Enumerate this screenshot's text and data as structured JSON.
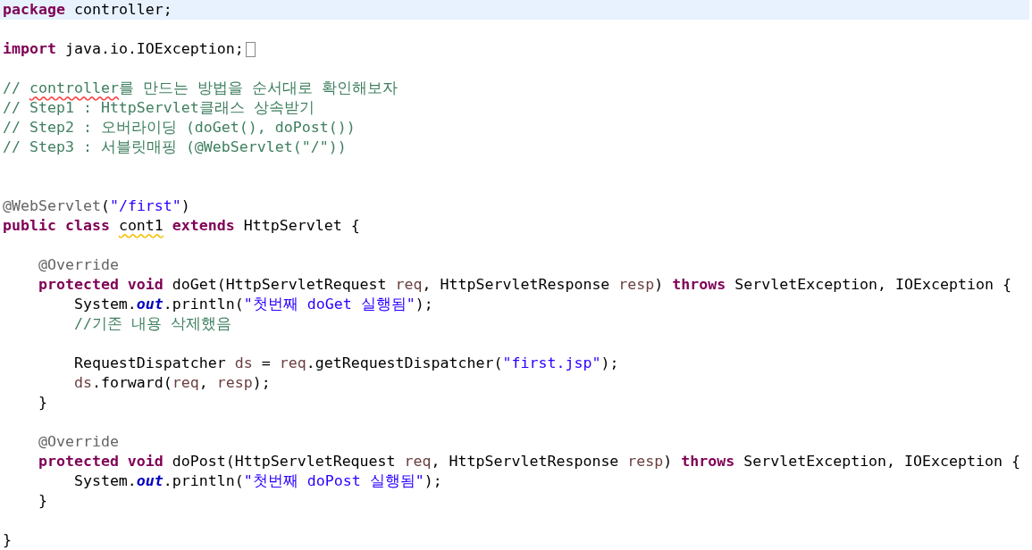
{
  "editor": {
    "lines": [
      {
        "current": true,
        "folded": false,
        "tokens": [
          {
            "kind": "keyword",
            "text": "package"
          },
          {
            "kind": "plain",
            "text": " controller;"
          }
        ]
      },
      {
        "current": false,
        "folded": false
      },
      {
        "current": false,
        "folded": true,
        "tokens": [
          {
            "kind": "keyword",
            "text": "import"
          },
          {
            "kind": "plain",
            "text": " java.io.IOException;"
          }
        ]
      },
      {
        "current": false,
        "folded": false
      },
      {
        "current": false,
        "folded": false,
        "tokens": [
          {
            "kind": "comment",
            "text": "// "
          },
          {
            "kind": "comment",
            "text": "controller",
            "misspelled": true
          },
          {
            "kind": "comment",
            "text": "를 만드는 방법을 순서대로 확인해보자"
          }
        ]
      },
      {
        "current": false,
        "folded": false,
        "tokens": [
          {
            "kind": "comment",
            "text": "// Step1 : HttpServlet클래스 상속받기"
          }
        ]
      },
      {
        "current": false,
        "folded": false,
        "tokens": [
          {
            "kind": "comment",
            "text": "// Step2 : 오버라이딩 (doGet(), doPost())"
          }
        ]
      },
      {
        "current": false,
        "folded": false,
        "tokens": [
          {
            "kind": "comment",
            "text": "// Step3 : 서블릿매핑 (@WebServlet(\"/\"))"
          }
        ]
      },
      {
        "current": false,
        "folded": false
      },
      {
        "current": false,
        "folded": false
      },
      {
        "current": false,
        "folded": false,
        "tokens": [
          {
            "kind": "annotation",
            "text": "@WebServlet"
          },
          {
            "kind": "plain",
            "text": "("
          },
          {
            "kind": "string",
            "text": "\"/first\""
          },
          {
            "kind": "plain",
            "text": ")"
          }
        ]
      },
      {
        "current": false,
        "folded": false,
        "tokens": [
          {
            "kind": "keyword",
            "text": "public "
          },
          {
            "kind": "keyword",
            "text": "class "
          },
          {
            "kind": "plain",
            "text": "cont1",
            "warning": true
          },
          {
            "kind": "keyword",
            "text": " extends"
          },
          {
            "kind": "plain",
            "text": " HttpServlet {"
          }
        ],
        "children": [
          {
            "current": false,
            "folded": false
          },
          {
            "current": false,
            "folded": false,
            "tokens": [
              {
                "kind": "annotation",
                "text": "@Override"
              }
            ]
          },
          {
            "current": false,
            "folded": false,
            "tokens": [
              {
                "kind": "keyword",
                "text": "protected "
              },
              {
                "kind": "keyword",
                "text": "void"
              },
              {
                "kind": "plain",
                "text": " doGet(HttpServletRequest "
              },
              {
                "kind": "variable",
                "text": "req"
              },
              {
                "kind": "plain",
                "text": ", HttpServletResponse "
              },
              {
                "kind": "variable",
                "text": "resp"
              },
              {
                "kind": "plain",
                "text": ") "
              },
              {
                "kind": "keyword",
                "text": "throws"
              },
              {
                "kind": "plain",
                "text": " ServletException, IOException {"
              }
            ],
            "children": [
              {
                "current": false,
                "folded": false,
                "tokens": [
                  {
                    "kind": "plain",
                    "text": "System."
                  },
                  {
                    "kind": "field",
                    "text": "out"
                  },
                  {
                    "kind": "plain",
                    "text": ".println("
                  },
                  {
                    "kind": "string",
                    "text": "\"첫번째 doGet 실행됨\""
                  },
                  {
                    "kind": "plain",
                    "text": ");"
                  }
                ]
              },
              {
                "current": false,
                "folded": false,
                "tokens": [
                  {
                    "kind": "comment",
                    "text": "//기존 내용 삭제했음"
                  }
                ]
              },
              {
                "current": false,
                "folded": false
              },
              {
                "current": false,
                "folded": false,
                "tokens": [
                  {
                    "kind": "plain",
                    "text": "RequestDispatcher "
                  },
                  {
                    "kind": "variable",
                    "text": "ds"
                  },
                  {
                    "kind": "plain",
                    "text": " = "
                  },
                  {
                    "kind": "variable",
                    "text": "req"
                  },
                  {
                    "kind": "plain",
                    "text": ".getRequestDispatcher("
                  },
                  {
                    "kind": "string",
                    "text": "\"first.jsp\""
                  },
                  {
                    "kind": "plain",
                    "text": ");"
                  }
                ]
              },
              {
                "current": false,
                "folded": false,
                "tokens": [
                  {
                    "kind": "variable",
                    "text": "ds"
                  },
                  {
                    "kind": "plain",
                    "text": ".forward("
                  },
                  {
                    "kind": "variable",
                    "text": "req"
                  },
                  {
                    "kind": "plain",
                    "text": ", "
                  },
                  {
                    "kind": "variable",
                    "text": "resp"
                  },
                  {
                    "kind": "plain",
                    "text": ");"
                  }
                ]
              }
            ]
          },
          {
            "current": false,
            "folded": false,
            "tokens": [
              {
                "kind": "plain",
                "text": "}"
              }
            ]
          },
          {
            "current": false,
            "folded": false
          },
          {
            "current": false,
            "folded": false,
            "tokens": [
              {
                "kind": "annotation",
                "text": "@Override"
              }
            ]
          },
          {
            "current": false,
            "folded": false,
            "tokens": [
              {
                "kind": "keyword",
                "text": "protected "
              },
              {
                "kind": "keyword",
                "text": "void"
              },
              {
                "kind": "plain",
                "text": " doPost(HttpServletRequest "
              },
              {
                "kind": "variable",
                "text": "req"
              },
              {
                "kind": "plain",
                "text": ", HttpServletResponse "
              },
              {
                "kind": "variable",
                "text": "resp"
              },
              {
                "kind": "plain",
                "text": ") "
              },
              {
                "kind": "keyword",
                "text": "throws"
              },
              {
                "kind": "plain",
                "text": " ServletException, IOException {"
              }
            ],
            "children": [
              {
                "current": false,
                "folded": false,
                "tokens": [
                  {
                    "kind": "plain",
                    "text": "System."
                  },
                  {
                    "kind": "field",
                    "text": "out"
                  },
                  {
                    "kind": "plain",
                    "text": ".println("
                  },
                  {
                    "kind": "string",
                    "text": "\"첫번째 doPost 실행됨\""
                  },
                  {
                    "kind": "plain",
                    "text": ");"
                  }
                ]
              }
            ]
          },
          {
            "current": false,
            "folded": false,
            "tokens": [
              {
                "kind": "plain",
                "text": "}"
              }
            ]
          },
          {
            "current": false,
            "folded": false
          }
        ]
      },
      {
        "current": false,
        "folded": false,
        "tokens": [
          {
            "kind": "plain",
            "text": "}"
          }
        ]
      }
    ]
  }
}
